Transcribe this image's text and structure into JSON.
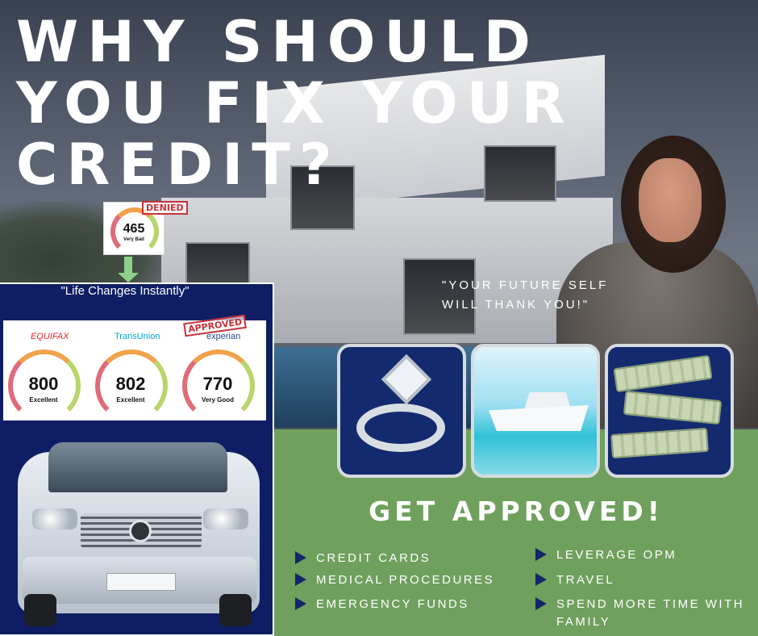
{
  "title": {
    "line1": "WHY SHOULD",
    "line2": "YOU FIX YOUR",
    "line3": "CREDIT?"
  },
  "denied": {
    "score": "465",
    "rating": "Very Bad",
    "stamp": "DENIED"
  },
  "panel": {
    "quote": "\"Life Changes Instantly\""
  },
  "bureaus": [
    {
      "name": "EQUIFAX",
      "score": "800",
      "rating": "Excellent",
      "color": "#d6262c"
    },
    {
      "name": "TransUnion",
      "score": "802",
      "rating": "Excellent",
      "color": "#00a6ca"
    },
    {
      "name": "experian",
      "score": "770",
      "rating": "Very Good",
      "color": "#26478d"
    }
  ],
  "approved_stamp": "APPROVED",
  "future_quote": {
    "line1": "\"YOUR FUTURE SELF",
    "line2": "WILL THANK YOU!\""
  },
  "get_approved": "GET APPROVED!",
  "benefits_left": [
    "CREDIT CARDS",
    "MEDICAL PROCEDURES",
    "EMERGENCY FUNDS"
  ],
  "benefits_right": [
    "LEVERAGE OPM",
    "TRAVEL",
    "SPEND MORE TIME WITH",
    "FAMILY"
  ],
  "colors": {
    "navy": "#0f1e64",
    "green": "#6fa05d",
    "denied_red": "#c8323a",
    "arrow_green": "#8fd18a"
  }
}
